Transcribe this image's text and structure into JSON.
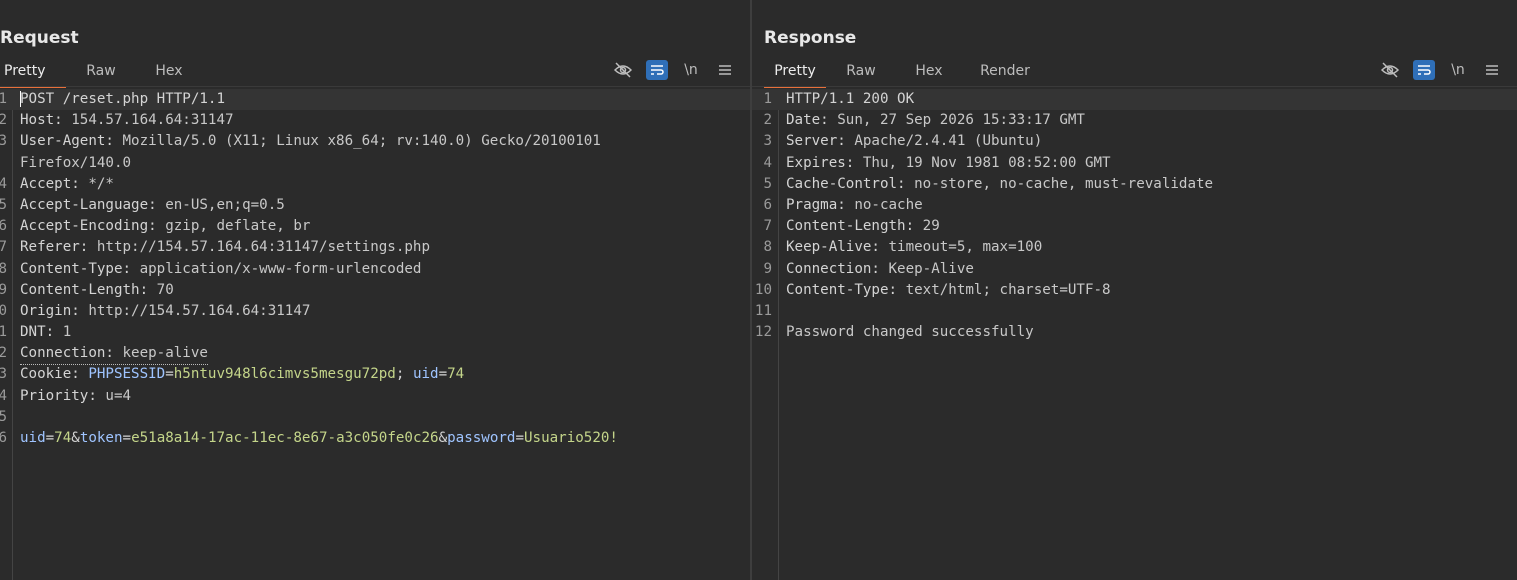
{
  "request": {
    "title": "Request",
    "tabs": [
      "Pretty",
      "Raw",
      "Hex"
    ],
    "active_tab": "Pretty",
    "tools": [
      "hide-icon",
      "wrap-icon",
      "newline-toggle",
      "menu-icon"
    ],
    "newline_label": "\\n",
    "lines": [
      {
        "num": "1",
        "parts": [
          [
            "k",
            "POST /reset.php HTTP/1.1"
          ]
        ]
      },
      {
        "num": "2",
        "parts": [
          [
            "k",
            "Host: "
          ],
          [
            "v",
            "154.57.164.64:31147"
          ]
        ]
      },
      {
        "num": "3",
        "parts": [
          [
            "k",
            "User-Agent: "
          ],
          [
            "v",
            "Mozilla/5.0 (X11; Linux x86_64; rv:140.0) Gecko/20100101"
          ]
        ]
      },
      {
        "num": "",
        "parts": [
          [
            "v",
            "Firefox/140.0"
          ]
        ]
      },
      {
        "num": "4",
        "parts": [
          [
            "k",
            "Accept: "
          ],
          [
            "v",
            "*/*"
          ]
        ]
      },
      {
        "num": "5",
        "parts": [
          [
            "k",
            "Accept-Language: "
          ],
          [
            "v",
            "en-US,en;q=0.5"
          ]
        ]
      },
      {
        "num": "6",
        "parts": [
          [
            "k",
            "Accept-Encoding: "
          ],
          [
            "v",
            "gzip, deflate, br"
          ]
        ]
      },
      {
        "num": "7",
        "parts": [
          [
            "k",
            "Referer: "
          ],
          [
            "v",
            "http://154.57.164.64:31147/settings.php"
          ]
        ]
      },
      {
        "num": "8",
        "parts": [
          [
            "k",
            "Content-Type: "
          ],
          [
            "v",
            "application/x-www-form-urlencoded"
          ]
        ]
      },
      {
        "num": "9",
        "parts": [
          [
            "k",
            "Content-Length: "
          ],
          [
            "v",
            "70"
          ]
        ]
      },
      {
        "num": "0",
        "parts": [
          [
            "k",
            "Origin: "
          ],
          [
            "v",
            "http://154.57.164.64:31147"
          ]
        ]
      },
      {
        "num": "1",
        "parts": [
          [
            "k",
            "DNT: "
          ],
          [
            "v",
            "1"
          ]
        ]
      },
      {
        "num": "2",
        "parts": [
          [
            "k",
            "Connection: "
          ],
          [
            "v",
            "keep-alive"
          ]
        ],
        "dotted": true
      },
      {
        "num": "3",
        "parts": [
          [
            "k",
            "Cookie: "
          ],
          [
            "b",
            "PHPSESSID"
          ],
          [
            "k",
            "="
          ],
          [
            "g",
            "h5ntuv948l6cimvs5mesgu72pd"
          ],
          [
            "k",
            "; "
          ],
          [
            "b",
            "uid"
          ],
          [
            "k",
            "="
          ],
          [
            "g",
            "74"
          ]
        ]
      },
      {
        "num": "4",
        "parts": [
          [
            "k",
            "Priority: "
          ],
          [
            "v",
            "u=4"
          ]
        ]
      },
      {
        "num": "5",
        "parts": []
      },
      {
        "num": "6",
        "parts": [
          [
            "b",
            "uid"
          ],
          [
            "k",
            "="
          ],
          [
            "g",
            "74"
          ],
          [
            "k",
            "&"
          ],
          [
            "b",
            "token"
          ],
          [
            "k",
            "="
          ],
          [
            "g",
            "e51a8a14-17ac-11ec-8e67-a3c050fe0c26"
          ],
          [
            "k",
            "&"
          ],
          [
            "b",
            "password"
          ],
          [
            "k",
            "="
          ],
          [
            "g",
            "Usuario520!"
          ]
        ]
      }
    ]
  },
  "response": {
    "title": "Response",
    "tabs": [
      "Pretty",
      "Raw",
      "Hex",
      "Render"
    ],
    "active_tab": "Pretty",
    "newline_label": "\\n",
    "lines": [
      {
        "num": "1",
        "parts": [
          [
            "k",
            "HTTP/1.1 200 OK"
          ]
        ]
      },
      {
        "num": "2",
        "parts": [
          [
            "k",
            "Date: "
          ],
          [
            "v",
            "Sun, 27 Sep 2026 15:33:17 GMT"
          ]
        ]
      },
      {
        "num": "3",
        "parts": [
          [
            "k",
            "Server: "
          ],
          [
            "v",
            "Apache/2.4.41 (Ubuntu)"
          ]
        ]
      },
      {
        "num": "4",
        "parts": [
          [
            "k",
            "Expires: "
          ],
          [
            "v",
            "Thu, 19 Nov 1981 08:52:00 GMT"
          ]
        ]
      },
      {
        "num": "5",
        "parts": [
          [
            "k",
            "Cache-Control: "
          ],
          [
            "v",
            "no-store, no-cache, must-revalidate"
          ]
        ]
      },
      {
        "num": "6",
        "parts": [
          [
            "k",
            "Pragma: "
          ],
          [
            "v",
            "no-cache"
          ]
        ]
      },
      {
        "num": "7",
        "parts": [
          [
            "k",
            "Content-Length: "
          ],
          [
            "v",
            "29"
          ]
        ]
      },
      {
        "num": "8",
        "parts": [
          [
            "k",
            "Keep-Alive: "
          ],
          [
            "v",
            "timeout=5, max=100"
          ]
        ]
      },
      {
        "num": "9",
        "parts": [
          [
            "k",
            "Connection: "
          ],
          [
            "v",
            "Keep-Alive"
          ]
        ]
      },
      {
        "num": "10",
        "parts": [
          [
            "k",
            "Content-Type: "
          ],
          [
            "v",
            "text/html; charset=UTF-8"
          ]
        ]
      },
      {
        "num": "11",
        "parts": []
      },
      {
        "num": "12",
        "parts": [
          [
            "v",
            "Password changed successfully"
          ]
        ]
      }
    ]
  },
  "layout_modes": [
    "split-vertical-icon",
    "split-horizontal-icon",
    "single-pane-icon"
  ],
  "colors": {
    "accent_tab": "#e8703a",
    "button_blue": "#2f6fb8",
    "param_name": "#9fc4ff",
    "param_value": "#c4d58a"
  }
}
